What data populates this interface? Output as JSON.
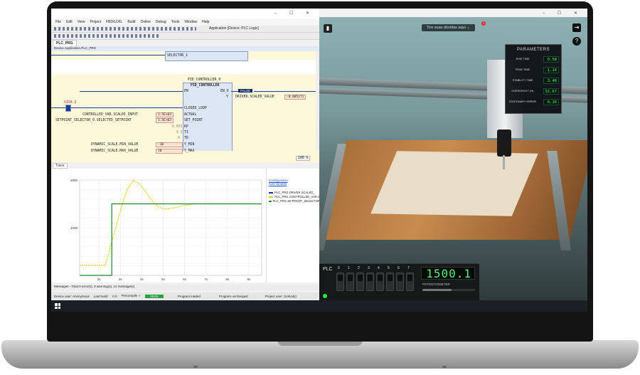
{
  "ide": {
    "window_controls": "–  ☐  ✕",
    "menu": [
      "File",
      "Edit",
      "View",
      "Project",
      "FBD/LD/IL",
      "Build",
      "Online",
      "Debug",
      "Tools",
      "Window",
      "Help"
    ],
    "application_selector": "Application [Device: PLC Logic]",
    "doc_tab": "PLC_PRG",
    "breadcrumb": "Device.Application.PLC_PRG",
    "code": {
      "selector_label": "SELECTOR_1",
      "block_instance": "PID_CONTROLLER_0",
      "block_type": "PID_CONTROLLER",
      "en_in": "EN",
      "en_out": "EN_O",
      "y_out": "Y",
      "false_badge": "FALSE",
      "output_var": "DRIVER.SCALED_VALUE",
      "output_value": "-0.005271",
      "address": "%IX0.2",
      "inputs": [
        {
          "name": "CONTROLLED_VAR.SCALED_INPUT",
          "value": "1.5E+03",
          "pin": "ACTUAL"
        },
        {
          "name": "SETPOINT_SELECTOR_0.SELECTED_SETPOINT",
          "value": "1.5E+03",
          "pin": "SET_POINT"
        },
        {
          "name": "",
          "value": "0.003",
          "pin": "KP"
        },
        {
          "name": "",
          "value": "0.5",
          "pin": "TI"
        },
        {
          "name": "",
          "value": "0",
          "pin": "TD"
        },
        {
          "name": "DYNAMIC_SCALE.MIN_VALUE",
          "value": "-10",
          "pin": "Y_MIN"
        },
        {
          "name": "DYNAMIC_SCALE.MAX_VALUE",
          "value": "10",
          "pin": "Y_MAX"
        }
      ],
      "closed_loop": "CLOSED_LOOP",
      "zoom": "100 %"
    },
    "trace": {
      "tab": "Trace",
      "configuration_link": "Configuration",
      "add_variable_link": "Add Variable",
      "series": [
        {
          "name": "PLC_PRG.DRIVER.SCALED_",
          "color": "#1f2aa6"
        },
        {
          "name": "PLC_PRG.CONTROLLED_VAR.S",
          "color": "#e5c600"
        },
        {
          "name": "PLC_PRG.SETPOINT_SELECTOR",
          "color": "#1b8a2a"
        }
      ]
    },
    "messages": "Messages - Total 0 error(s), 0 warning(s), 12 message(s)",
    "status": {
      "device_user": "Device user: Anonymous",
      "last_build": "Last build:",
      "build_counts": "0 0",
      "precompile": "Precompile ✓",
      "run": "RUN",
      "program_loaded": "Program loaded",
      "program_unchanged": "Program unchanged",
      "project_user": "Project user: (nobody)"
    }
  },
  "chart_data": {
    "type": "line",
    "x_tick_labels": [
      "2s",
      "3s",
      "4s",
      "5s",
      "6s",
      "7s",
      "8s",
      "9s"
    ],
    "y_tick_labels": [
      "2000",
      "1000"
    ],
    "ylim": [
      0,
      2000
    ],
    "xlim": [
      1.1,
      9.6
    ],
    "grid": true,
    "series": [
      {
        "name": "PLC_PRG.CONTROLLED_VAR.S",
        "x": [
          1.1,
          2.3,
          2.6,
          3.0,
          3.3,
          3.6,
          3.9,
          4.2,
          4.5,
          4.8,
          5.1,
          5.5,
          6.0,
          6.5,
          7.0,
          9.6
        ],
        "y": [
          210,
          210,
          700,
          1350,
          1780,
          1990,
          1920,
          1740,
          1560,
          1430,
          1390,
          1420,
          1470,
          1500,
          1500,
          1500
        ]
      },
      {
        "name": "PLC_PRG.SETPOINT_SELECTOR",
        "x": [
          1.1,
          2.6,
          2.6,
          9.6
        ],
        "y": [
          0,
          0,
          1500,
          1500
        ]
      }
    ]
  },
  "sim": {
    "help_pill": "Tire suas dúvidas aqui",
    "help_badge": "1",
    "parameters": {
      "title": "PARAMETERS",
      "rows": [
        {
          "label": "RISE TIME",
          "value": "0.58"
        },
        {
          "label": "PEAK TIME",
          "value": "1.14"
        },
        {
          "label": "STABILITY TIME",
          "value": "3.48"
        },
        {
          "label": "OVERSHOOT (%)",
          "value": "32.67"
        },
        {
          "label": "STATIONARY ERROR",
          "value": "0.16"
        }
      ]
    },
    "plc": {
      "label": "PLC",
      "switch_numbers": [
        "0",
        "1",
        "2",
        "3",
        "4",
        "5",
        "6",
        "7"
      ],
      "display_value": "1500.1",
      "potentiometer_label": "POTENTIOMETER",
      "potentiometer_level": 0.55
    }
  }
}
